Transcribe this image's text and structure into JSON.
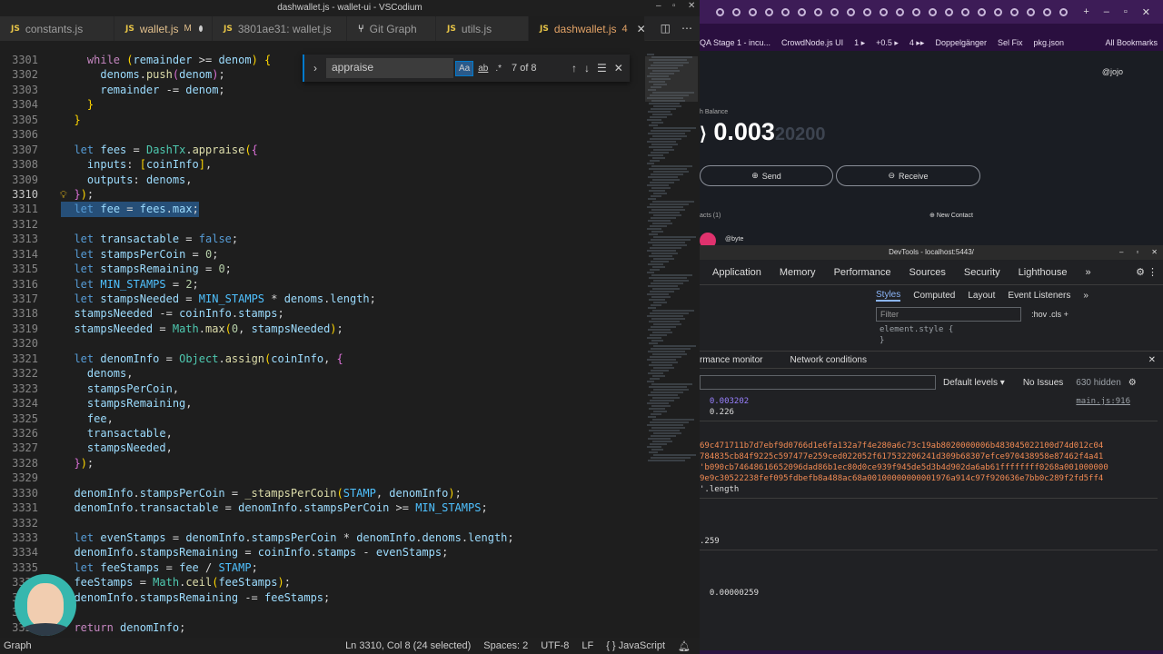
{
  "window_title": "dashwallet.js - wallet-ui - VSCodium",
  "tabs": [
    {
      "icon": "JS",
      "label": "constants.js",
      "suffix": "",
      "active": false
    },
    {
      "icon": "JS",
      "label": "wallet.js",
      "suffix": "M",
      "active": false,
      "dirty": true
    },
    {
      "icon": "JS",
      "label": "3801ae31: wallet.js",
      "suffix": "",
      "active": false
    },
    {
      "icon": "git",
      "label": "Git Graph",
      "suffix": "",
      "active": false
    },
    {
      "icon": "JS",
      "label": "utils.js",
      "suffix": "",
      "active": false
    },
    {
      "icon": "JS",
      "label": "dashwallet.js",
      "suffix": "4",
      "active": true
    }
  ],
  "find": {
    "query": "appraise",
    "count": "7 of 8",
    "options": [
      "Aa",
      "ab",
      ".*"
    ]
  },
  "code_lines": [
    {
      "n": "3301",
      "html": "    <span class='ctl'>while</span> <span class='br'>(</span><span class='vr'>remainder</span> >= <span class='vr'>denom</span><span class='br'>)</span> <span class='br'>{</span>"
    },
    {
      "n": "3302",
      "html": "      <span class='vr'>denoms</span>.<span class='fn'>push</span><span class='br2'>(</span><span class='vr'>denom</span><span class='br2'>)</span>;"
    },
    {
      "n": "3303",
      "html": "      <span class='vr'>remainder</span> -= <span class='vr'>denom</span>;"
    },
    {
      "n": "3304",
      "html": "    <span class='br'>}</span>"
    },
    {
      "n": "3305",
      "html": "  <span class='br'>}</span>"
    },
    {
      "n": "3306",
      "html": ""
    },
    {
      "n": "3307",
      "html": "  <span class='kw'>let</span> <span class='vr'>fees</span> = <span class='cls'>DashTx</span>.<span class='fn'>appraise</span><span class='br'>(</span><span class='br2'>{</span>"
    },
    {
      "n": "3308",
      "html": "    <span class='vr'>inputs</span>: <span class='br'>[</span><span class='vr'>coinInfo</span><span class='br'>]</span>,"
    },
    {
      "n": "3309",
      "html": "    <span class='vr'>outputs</span>: <span class='vr'>denoms</span>,"
    },
    {
      "n": "3310",
      "html": "  <span class='br2'>}</span><span class='br'>)</span>;",
      "current": true,
      "bulb": true
    },
    {
      "n": "3311",
      "html": "  <span class='kw'>let</span> <span class='vr'>fee</span> = <span class='vr'>fees</span>.<span class='vr'>max</span>;",
      "selected": true
    },
    {
      "n": "3312",
      "html": ""
    },
    {
      "n": "3313",
      "html": "  <span class='kw'>let</span> <span class='vr'>transactable</span> = <span class='kw'>false</span>;"
    },
    {
      "n": "3314",
      "html": "  <span class='kw'>let</span> <span class='vr'>stampsPerCoin</span> = <span class='num'>0</span>;"
    },
    {
      "n": "3315",
      "html": "  <span class='kw'>let</span> <span class='vr'>stampsRemaining</span> = <span class='num'>0</span>;"
    },
    {
      "n": "3316",
      "html": "  <span class='kw'>let</span> <span class='cst'>MIN_STAMPS</span> = <span class='num'>2</span>;"
    },
    {
      "n": "3317",
      "html": "  <span class='kw'>let</span> <span class='vr'>stampsNeeded</span> = <span class='cst'>MIN_STAMPS</span> * <span class='vr'>denoms</span>.<span class='vr'>length</span>;"
    },
    {
      "n": "3318",
      "html": "  <span class='vr'>stampsNeeded</span> -= <span class='vr'>coinInfo</span>.<span class='vr'>stamps</span>;"
    },
    {
      "n": "3319",
      "html": "  <span class='vr'>stampsNeeded</span> = <span class='cls'>Math</span>.<span class='fn'>max</span><span class='br'>(</span><span class='num'>0</span>, <span class='vr'>stampsNeeded</span><span class='br'>)</span>;"
    },
    {
      "n": "3320",
      "html": ""
    },
    {
      "n": "3321",
      "html": "  <span class='kw'>let</span> <span class='vr'>denomInfo</span> = <span class='cls'>Object</span>.<span class='fn'>assign</span><span class='br'>(</span><span class='vr'>coinInfo</span>, <span class='br2'>{</span>"
    },
    {
      "n": "3322",
      "html": "    <span class='vr'>denoms</span>,"
    },
    {
      "n": "3323",
      "html": "    <span class='vr'>stampsPerCoin</span>,"
    },
    {
      "n": "3324",
      "html": "    <span class='vr'>stampsRemaining</span>,"
    },
    {
      "n": "3325",
      "html": "    <span class='vr'>fee</span>,"
    },
    {
      "n": "3326",
      "html": "    <span class='vr'>transactable</span>,"
    },
    {
      "n": "3327",
      "html": "    <span class='vr'>stampsNeeded</span>,"
    },
    {
      "n": "3328",
      "html": "  <span class='br2'>}</span><span class='br'>)</span>;"
    },
    {
      "n": "3329",
      "html": ""
    },
    {
      "n": "3330",
      "html": "  <span class='vr'>denomInfo</span>.<span class='vr'>stampsPerCoin</span> = <span class='fn'>_stampsPerCoin</span><span class='br'>(</span><span class='cst'>STAMP</span>, <span class='vr'>denomInfo</span><span class='br'>)</span>;"
    },
    {
      "n": "3331",
      "html": "  <span class='vr'>denomInfo</span>.<span class='vr'>transactable</span> = <span class='vr'>denomInfo</span>.<span class='vr'>stampsPerCoin</span> >= <span class='cst'>MIN_STAMPS</span>;"
    },
    {
      "n": "3332",
      "html": ""
    },
    {
      "n": "3333",
      "html": "  <span class='kw'>let</span> <span class='vr'>evenStamps</span> = <span class='vr'>denomInfo</span>.<span class='vr'>stampsPerCoin</span> * <span class='vr'>denomInfo</span>.<span class='vr'>denoms</span>.<span class='vr'>length</span>;"
    },
    {
      "n": "3334",
      "html": "  <span class='vr'>denomInfo</span>.<span class='vr'>stampsRemaining</span> = <span class='vr'>coinInfo</span>.<span class='vr'>stamps</span> - <span class='vr'>evenStamps</span>;"
    },
    {
      "n": "3335",
      "html": "  <span class='kw'>let</span> <span class='vr'>feeStamps</span> = <span class='vr'>fee</span> / <span class='cst'>STAMP</span>;"
    },
    {
      "n": "3336",
      "html": "  <span class='vr'>feeStamps</span> = <span class='cls'>Math</span>.<span class='fn'>ceil</span><span class='br'>(</span><span class='vr'>feeStamps</span><span class='br'>)</span>;"
    },
    {
      "n": "3337",
      "html": "  <span class='vr'>denomInfo</span>.<span class='vr'>stampsRemaining</span> -= <span class='vr'>feeStamps</span>;"
    },
    {
      "n": "3338",
      "html": ""
    },
    {
      "n": "3339",
      "html": "  <span class='ctl'>return</span> <span class='vr'>denomInfo</span>;"
    }
  ],
  "status": {
    "left": "Graph",
    "cursor": "Ln 3310, Col 8 (24 selected)",
    "spaces": "Spaces: 2",
    "encoding": "UTF-8",
    "eol": "LF",
    "language": "{ } JavaScript"
  },
  "browser": {
    "bookmarks": [
      "QA Stage 1 - incu...",
      "CrowdNode.js UI",
      "1 ▸",
      "+0.5 ▸",
      "4 ▸▸",
      "Doppelgänger",
      "Sel Fix",
      "pkg.json"
    ],
    "all_bookmarks": "All Bookmarks",
    "handle": "@jojo",
    "balance_label": "h Balance",
    "balance_main": "0.003",
    "balance_dim": "20200",
    "balance_prefix": "Đ",
    "send": "Send",
    "receive": "Receive",
    "contacts": "acts (1)",
    "new_contact": "New Contact",
    "contact_name": "@byte"
  },
  "devtools": {
    "title": "DevTools - localhost:5443/",
    "tabs": [
      "Application",
      "Memory",
      "Performance",
      "Sources",
      "Security",
      "Lighthouse",
      "»"
    ],
    "styles_tabs": [
      "Styles",
      "Computed",
      "Layout",
      "Event Listeners",
      "»"
    ],
    "filter_placeholder": "Filter",
    "filter_opts": ":hov  .cls  +",
    "element_style": "element.style {",
    "element_style_close": "}",
    "drawer_tabs": [
      "rmance monitor",
      "Network conditions"
    ],
    "default_levels": "Default levels ▾",
    "no_issues": "No Issues",
    "hidden": "630 hidden",
    "console_lines": [
      {
        "type": "num",
        "text": "  0.003202",
        "src": "main.js:916"
      },
      {
        "type": "plain",
        "text": "  0.226"
      },
      {
        "type": "str",
        "text": "69c471711b7d7ebf9d0766d1e6fa132a7f4e280a6c73c19ab8020000006b483045022100d74d012c04"
      },
      {
        "type": "str",
        "text": "784835cb84f9225c597477e259ced022052f617532206241d309b68307efce970438958e87462f4a41"
      },
      {
        "type": "str",
        "text": "'b090cb74648616652096dad86b1ec80d0ce939f945de5d3b4d902da6ab61ffffffff0268a001000000"
      },
      {
        "type": "str",
        "text": "9e9c30522238fef095fdbefb8a488ac68a00100000000001976a914c97f920636e7bb0c289f2fd5ff4"
      },
      {
        "type": "plain",
        "text": "'.length"
      },
      {
        "type": "plain",
        "text": ".259"
      },
      {
        "type": "plain",
        "text": "  0.00000259"
      }
    ]
  }
}
